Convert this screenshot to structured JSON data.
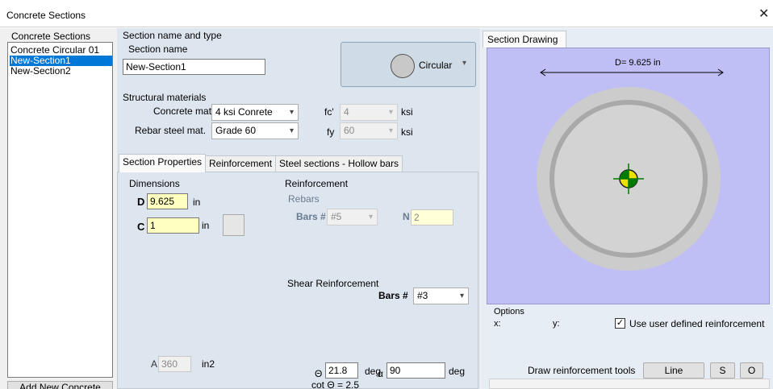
{
  "window": {
    "title": "Concrete Sections",
    "close_glyph": "✕"
  },
  "left": {
    "group_label": "Concrete Sections",
    "items": [
      "Concrete Circular 01",
      "New-Section1",
      "New-Section2"
    ],
    "selected_index": 1,
    "add_button": "Add New Concrete"
  },
  "section": {
    "group_label": "Section name and type",
    "name_label": "Section name",
    "name_value": "New-Section1",
    "type_label": "Circular",
    "type_icon": "circle-icon"
  },
  "materials": {
    "group_label": "Structural materials",
    "concrete_label": "Concrete mat.",
    "concrete_value": "4 ksi Conrete",
    "rebar_label": "Rebar steel mat.",
    "rebar_value": "Grade 60",
    "fc_label": "fc'",
    "fc_value": "4",
    "fc_unit": "ksi",
    "fy_label": "fy",
    "fy_value": "60",
    "fy_unit": "ksi"
  },
  "tabs": [
    "Section Properties",
    "Reinforcement",
    "Steel sections - Hollow bars"
  ],
  "active_tab": 0,
  "dimensions": {
    "group_label": "Dimensions",
    "d_label": "D",
    "d_value": "9.625",
    "d_unit": "in",
    "c_label": "C",
    "c_value": "1",
    "c_unit": "in",
    "a_label": "A",
    "a_value": "360",
    "a_unit": "in2"
  },
  "reinforcement": {
    "group_label": "Reinforcement",
    "rebars_label": "Rebars",
    "bars_label": "Bars #",
    "bars_value": "#5",
    "n_label": "N",
    "n_value": "2",
    "shear_label": "Shear Reinforcement",
    "shear_bars_label": "Bars #",
    "shear_bars_value": "#3",
    "theta_symbol": "Θ",
    "theta_value": "21.8",
    "theta_unit": "deg",
    "alpha_symbol": "α",
    "alpha_value": "90",
    "alpha_unit": "deg",
    "cot_text": "cot Θ = 2.5"
  },
  "drawing": {
    "tab_label": "Section Drawing",
    "dimension_label": "D= 9.625 in",
    "background_color": "#bfbff6"
  },
  "options": {
    "label": "Options",
    "x_label": "x:",
    "y_label": "y:",
    "user_defined_label": "Use user defined reinforcement",
    "user_defined_checked": true,
    "tools_label": "Draw reinforcement tools",
    "line_button": "Line",
    "s_button": "S",
    "o_button": "O"
  }
}
